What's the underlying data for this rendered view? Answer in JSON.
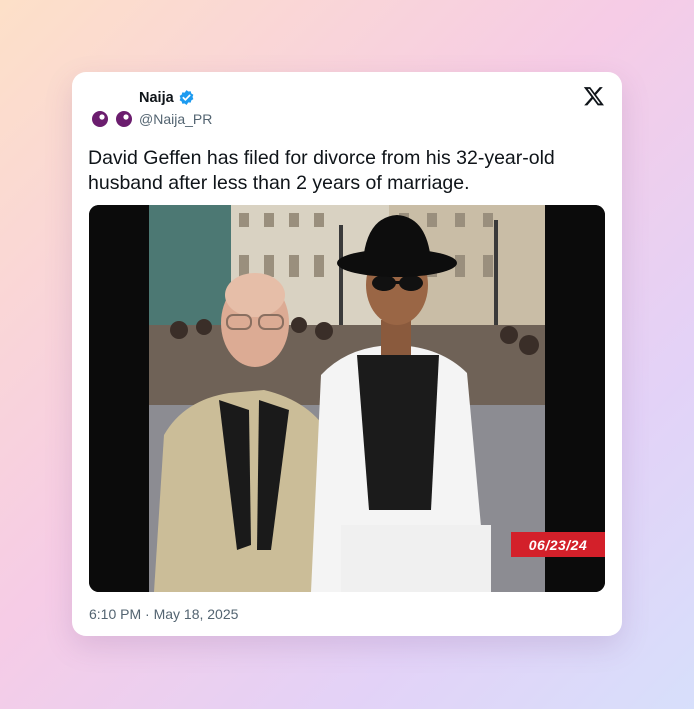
{
  "tweet": {
    "display_name": "Naija",
    "handle": "@Naija_PR",
    "text": "David Geffen has filed for divorce from his 32-year-old husband after less than 2 years of marriage.",
    "timestamp": "6:10 PM · May 18, 2025",
    "image_date_stamp": "06/23/24",
    "icons": [
      "naija-eyes-avatar-icon",
      "verified-badge-icon",
      "x-logo-icon"
    ]
  },
  "colors": {
    "verified_blue": "#1d9bf0",
    "avatar_purple": "#6b1d6e",
    "date_stamp_red": "#d3202a",
    "secondary_text": "#536471"
  }
}
